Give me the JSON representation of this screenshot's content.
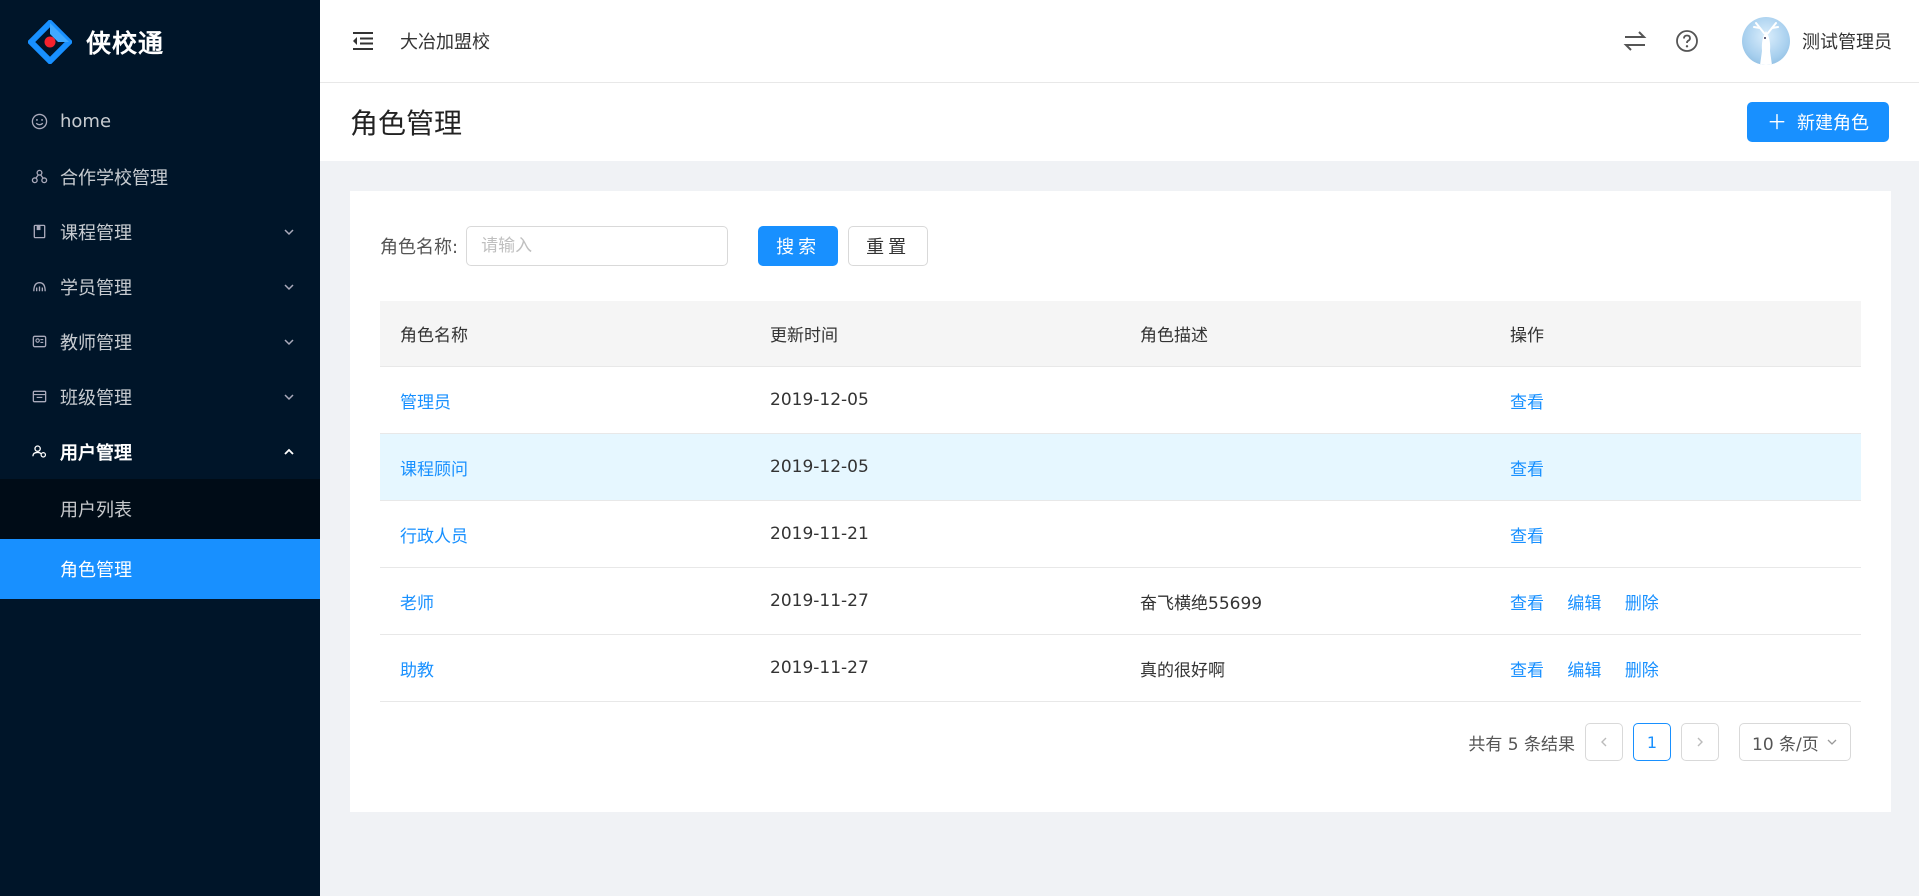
{
  "app": {
    "logo_text": "侠校通",
    "school": "大冶加盟校",
    "user_name": "测试管理员"
  },
  "sidebar": {
    "items": [
      {
        "label": "home",
        "icon": "smile-icon"
      },
      {
        "label": "合作学校管理",
        "icon": "cluster-icon"
      },
      {
        "label": "课程管理",
        "icon": "book-icon"
      },
      {
        "label": "学员管理",
        "icon": "team-icon"
      },
      {
        "label": "教师管理",
        "icon": "idcard-icon"
      },
      {
        "label": "班级管理",
        "icon": "schedule-icon"
      },
      {
        "label": "用户管理",
        "icon": "users-icon"
      }
    ],
    "sub_items": [
      {
        "label": "用户列表"
      },
      {
        "label": "角色管理"
      }
    ]
  },
  "page": {
    "title": "角色管理",
    "new_button": "新建角色"
  },
  "search": {
    "label": "角色名称:",
    "placeholder": "请输入",
    "search_button": "搜索",
    "reset_button": "重置"
  },
  "table": {
    "headers": [
      "角色名称",
      "更新时间",
      "角色描述",
      "操作"
    ],
    "rows": [
      {
        "name": "管理员",
        "updated": "2019-12-05",
        "desc": "",
        "ops": [
          "查看"
        ]
      },
      {
        "name": "课程顾问",
        "updated": "2019-12-05",
        "desc": "",
        "ops": [
          "查看"
        ]
      },
      {
        "name": "行政人员",
        "updated": "2019-11-21",
        "desc": "",
        "ops": [
          "查看"
        ]
      },
      {
        "name": "老师",
        "updated": "2019-11-27",
        "desc": "奋飞横绝55699",
        "ops": [
          "查看",
          "编辑",
          "删除"
        ]
      },
      {
        "name": "助教",
        "updated": "2019-11-27",
        "desc": "真的很好啊",
        "ops": [
          "查看",
          "编辑",
          "删除"
        ]
      }
    ]
  },
  "pagination": {
    "total_text": "共有 5 条结果",
    "current_page": "1",
    "page_size": "10 条/页"
  }
}
